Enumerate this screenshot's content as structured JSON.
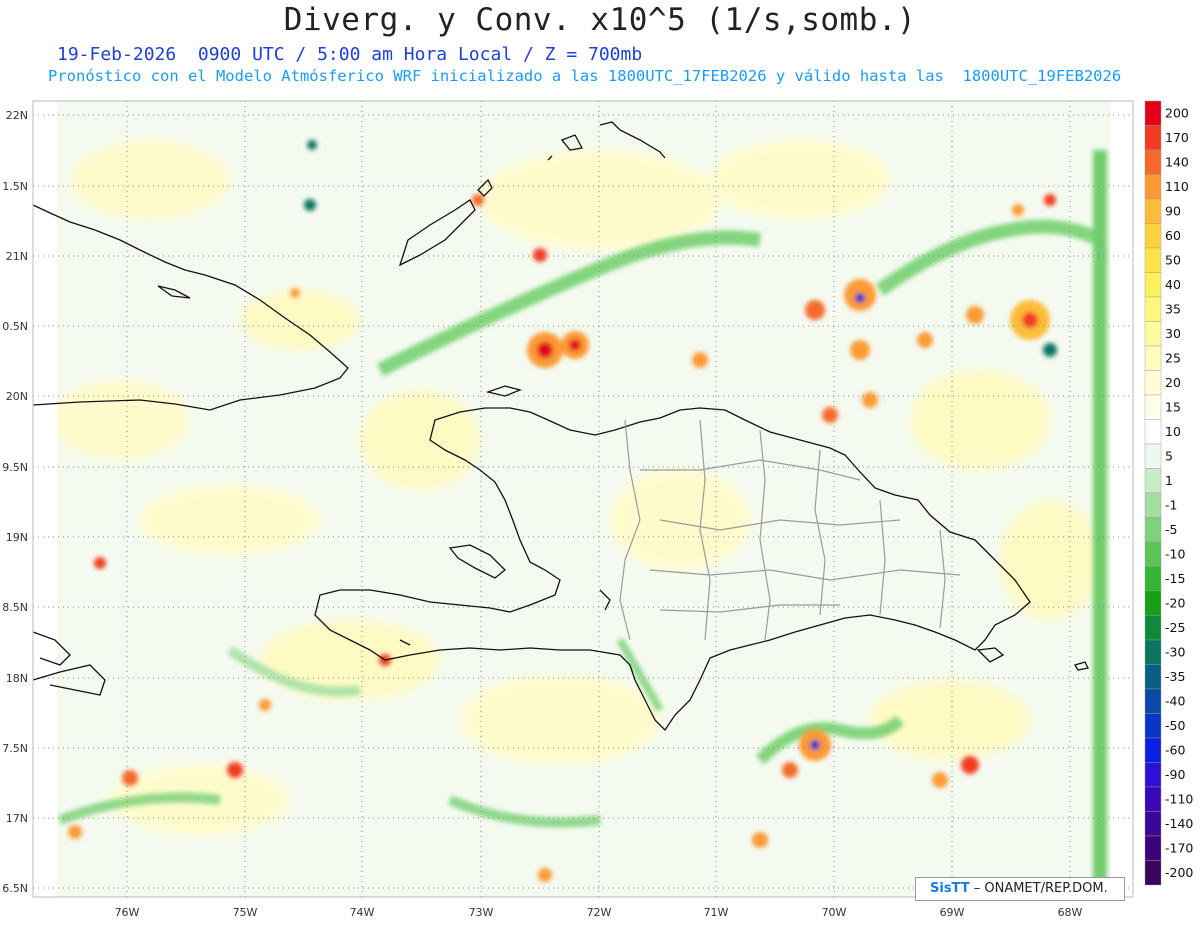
{
  "title": "Diverg. y Conv. x10^5 (1/s,somb.)",
  "subtitle_line1": "19-Feb-2026  0900 UTC / 5:00 am Hora Local / Z = 700mb",
  "subtitle_line2": "Pronóstico con el Modelo Atmósferico WRF inicializado a las 1800UTC_17FEB2026 y válido hasta las  1800UTC_19FEB2026",
  "lat_labels": [
    "22N",
    "1.5N",
    "21N",
    "0.5N",
    "20N",
    "9.5N",
    "19N",
    "8.5N",
    "18N",
    "7.5N",
    "17N",
    "6.5N"
  ],
  "lon_labels": [
    "76W",
    "75W",
    "74W",
    "73W",
    "72W",
    "71W",
    "70W",
    "69W",
    "68W"
  ],
  "colorbar": {
    "labels": [
      "200",
      "170",
      "140",
      "110",
      "90",
      "60",
      "50",
      "40",
      "35",
      "30",
      "25",
      "20",
      "15",
      "10",
      "5",
      "1",
      "-1",
      "-5",
      "-10",
      "-15",
      "-20",
      "-25",
      "-30",
      "-35",
      "-40",
      "-50",
      "-60",
      "-90",
      "-110",
      "-140",
      "-170",
      "-200"
    ],
    "colors": [
      "#e3001b",
      "#f03c20",
      "#f56a2a",
      "#fa9a34",
      "#fdbb3a",
      "#ffd13f",
      "#ffe34a",
      "#fff05c",
      "#fff77c",
      "#fffba0",
      "#fffcbf",
      "#fffdd8",
      "#fffee9",
      "#ffffff",
      "#eef8ee",
      "#c8ecc6",
      "#a4dfa2",
      "#7fd27c",
      "#5ac457",
      "#35b632",
      "#18a018",
      "#0e8a3a",
      "#0a7460",
      "#0b5f86",
      "#0a4aa8",
      "#0834c8",
      "#0a20e0",
      "#2a10d8",
      "#3a08b8",
      "#3c0698",
      "#3a0478",
      "#38045c"
    ]
  },
  "credit": {
    "logo": "SisTT",
    "text": "– ONAMET/REP.DOM."
  }
}
